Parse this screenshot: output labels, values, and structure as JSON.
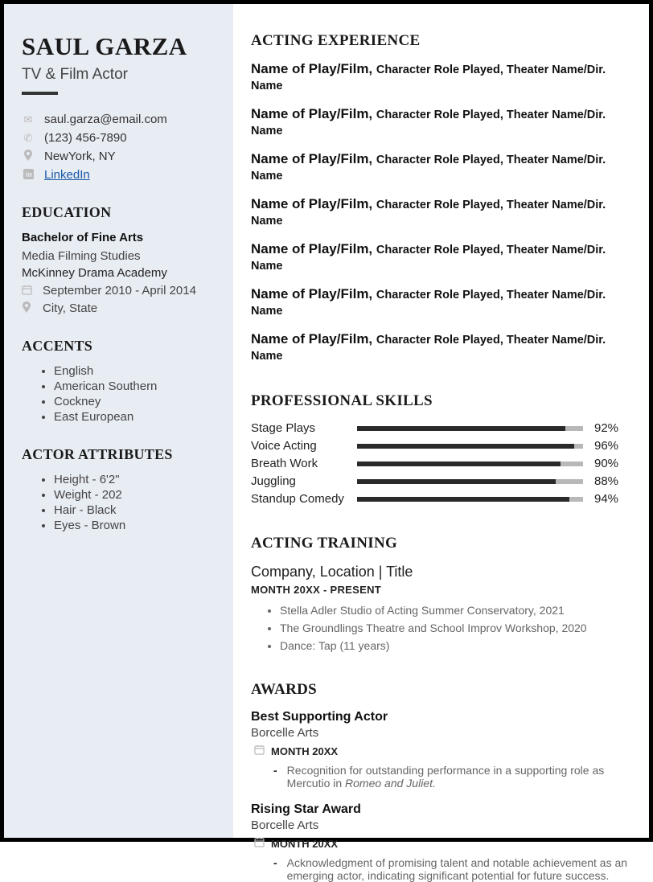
{
  "name": "SAUL GARZA",
  "subtitle": "TV & Film Actor",
  "contact": {
    "email": "saul.garza@email.com",
    "phone": "(123) 456-7890",
    "location": "NewYork, NY",
    "link": "LinkedIn"
  },
  "education": {
    "heading": "EDUCATION",
    "degree": "Bachelor of Fine Arts",
    "major": "Media Filming Studies",
    "school": "McKinney Drama Academy",
    "dates": "September 2010 - April 2014",
    "city": "City, State"
  },
  "accents": {
    "heading": "ACCENTS",
    "items": [
      "English",
      "American Southern",
      "Cockney",
      "East European"
    ]
  },
  "attributes": {
    "heading": "ACTOR ATTRIBUTES",
    "items": [
      "Height - 6'2\"",
      "Weight - 202",
      "Hair - Black",
      "Eyes -  Brown"
    ]
  },
  "experience": {
    "heading": "ACTING EXPERIENCE",
    "rows": [
      {
        "title": "Name of Play/Film,",
        "detail": "Character Role Played, Theater Name/Dir. Name"
      },
      {
        "title": "Name of Play/Film,",
        "detail": "Character Role Played, Theater Name/Dir. Name"
      },
      {
        "title": "Name of Play/Film,",
        "detail": "Character Role Played, Theater Name/Dir. Name"
      },
      {
        "title": "Name of Play/Film,",
        "detail": "Character Role Played, Theater Name/Dir. Name"
      },
      {
        "title": "Name of Play/Film,",
        "detail": "Character Role Played, Theater Name/Dir. Name"
      },
      {
        "title": "Name of Play/Film,",
        "detail": "Character Role Played, Theater Name/Dir. Name"
      },
      {
        "title": "Name of Play/Film,",
        "detail": "Character Role Played, Theater Name/Dir. Name"
      }
    ]
  },
  "skills": {
    "heading": "PROFESSIONAL SKILLS",
    "items": [
      {
        "label": "Stage Plays",
        "pct": 92
      },
      {
        "label": "Voice Acting",
        "pct": 96
      },
      {
        "label": "Breath Work",
        "pct": 90
      },
      {
        "label": "Juggling",
        "pct": 88
      },
      {
        "label": "Standup Comedy",
        "pct": 94
      }
    ]
  },
  "training": {
    "heading": "ACTING TRAINING",
    "title": "Company, Location | Title",
    "dates": "MONTH 20XX - PRESENT",
    "items": [
      "Stella Adler Studio of Acting Summer Conservatory, 2021",
      "The Groundlings Theatre and School Improv Workshop, 2020",
      "Dance: Tap (11 years)"
    ]
  },
  "awards": {
    "heading": "AWARDS",
    "items": [
      {
        "title": "Best Supporting Actor",
        "org": "Borcelle Arts",
        "date": "MONTH 20XX",
        "desc_pre": "Recognition for outstanding performance in a supporting role as Mercutio in ",
        "desc_italic": "Romeo and Juliet.",
        "desc_post": ""
      },
      {
        "title": "Rising Star Award",
        "org": "Borcelle Arts",
        "date": "MONTH 20XX",
        "desc_pre": "Acknowledgment of promising talent and notable achievement as an emerging actor, indicating significant potential for future success.",
        "desc_italic": "",
        "desc_post": ""
      }
    ]
  }
}
